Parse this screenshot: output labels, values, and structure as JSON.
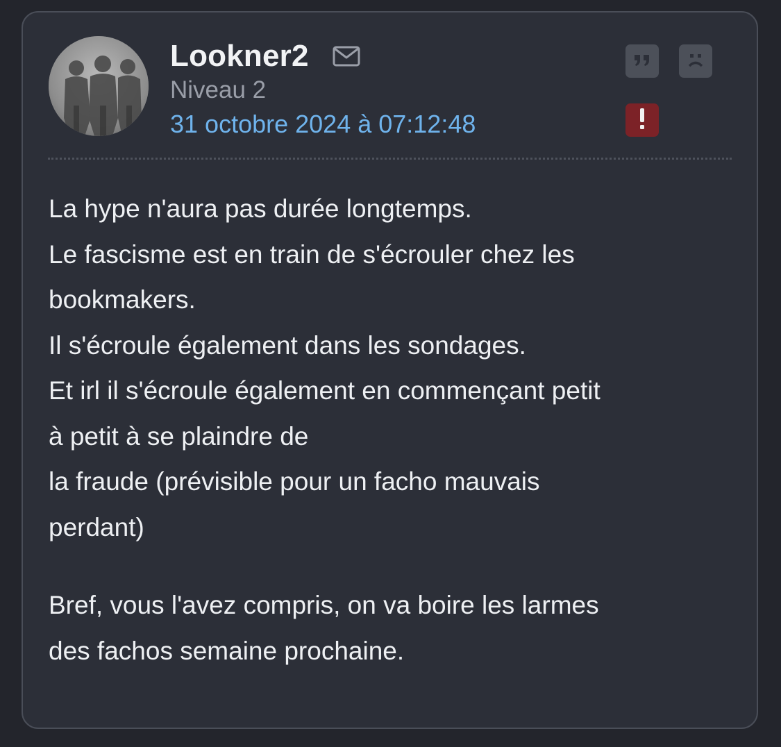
{
  "post": {
    "username": "Lookner2",
    "level": "Niveau 2",
    "date": "31 octobre 2024 à 07:12:48",
    "paragraph1_lines": [
      "La hype n'aura pas durée longtemps.",
      "Le fascisme est en train de s'écrouler chez les",
      "bookmakers.",
      "Il s'écroule également dans les sondages.",
      "Et irl il s'écroule également en commençant petit",
      "à petit à se plaindre de",
      "la fraude (prévisible pour un facho mauvais",
      "perdant)"
    ],
    "paragraph2_lines": [
      "Bref, vous l'avez compris, on va boire les larmes",
      "des fachos semaine prochaine."
    ]
  },
  "icons": {
    "mail": "mail-icon",
    "quote": "quote-icon",
    "sad": "sad-face-icon",
    "alert": "exclamation-icon",
    "avatar": "avatar-photo"
  },
  "colors": {
    "background": "#23252c",
    "card": "#2c2f38",
    "card_border": "#4a4e58",
    "username": "#f2f3f5",
    "level": "#9a9ea8",
    "date": "#6fb3ec",
    "body_text": "#eef0f3",
    "button_gray": "#4c5059",
    "button_alert": "#7c2227"
  }
}
